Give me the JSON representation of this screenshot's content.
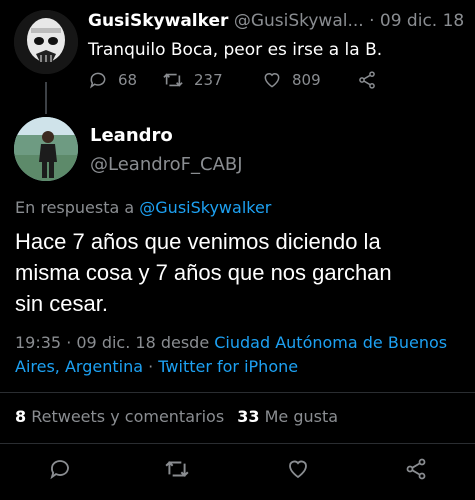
{
  "quoted_tweet": {
    "display_name": "GusiSkywalker",
    "handle_time": "@GusiSkywal...  · 09 dic. 18",
    "text": "Tranquilo Boca, peor es irse a la B.",
    "replies": "68",
    "retweets": "237",
    "likes": "809"
  },
  "main_tweet": {
    "display_name": "Leandro",
    "handle": "@LeandroF_CABJ",
    "reply_prefix": "En respuesta a ",
    "reply_to": "@GusiSkywalker",
    "text_line1": "Hace 7 años que venimos diciendo la",
    "text_line2": "misma cosa y 7 años que nos garchan",
    "text_line3": "sin cesar.",
    "time": "19:35 · 09 dic. 18 desde ",
    "location_line1": "Ciudad Autónoma de Buenos",
    "location_line2": "Aires, Argentina",
    "source_sep": " · ",
    "source": "Twitter for iPhone"
  },
  "stats": {
    "retweets_count": "8",
    "retweets_label": "Retweets y comentarios",
    "likes_count": "33",
    "likes_label": "Me gusta"
  },
  "icons": {
    "reply": "reply-icon",
    "retweet": "retweet-icon",
    "like": "heart-icon",
    "share": "share-icon"
  },
  "colors": {
    "background": "#000000",
    "link": "#1da1f2",
    "secondary": "#8a8d91"
  }
}
